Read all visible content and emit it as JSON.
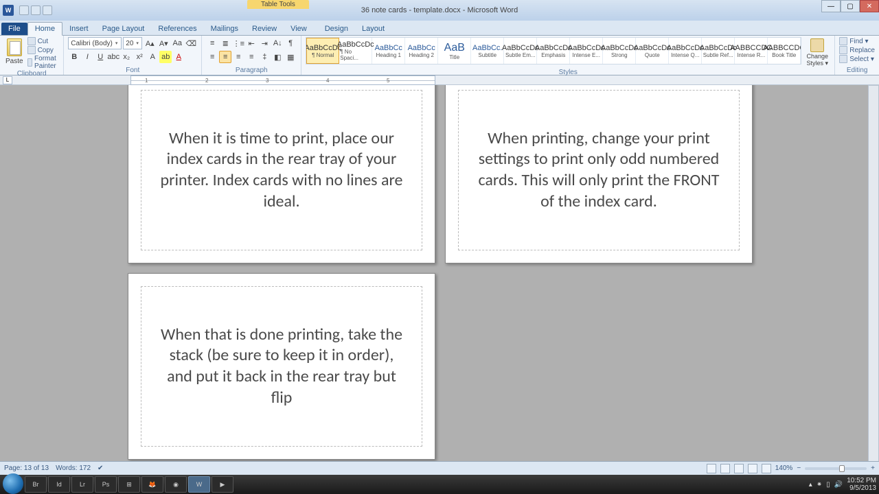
{
  "titlebar": {
    "app_letter": "W",
    "doc_title": "36 note cards - template.docx - Microsoft Word",
    "tool_tab": "Table Tools"
  },
  "tabs": {
    "file": "File",
    "items": [
      "Home",
      "Insert",
      "Page Layout",
      "References",
      "Mailings",
      "Review",
      "View",
      "Design",
      "Layout"
    ],
    "active": "Home"
  },
  "clipboard": {
    "label": "Clipboard",
    "paste": "Paste",
    "cut": "Cut",
    "copy": "Copy",
    "painter": "Format Painter"
  },
  "font": {
    "label": "Font",
    "name": "Calibri (Body)",
    "size": "20"
  },
  "paragraph": {
    "label": "Paragraph"
  },
  "styles": {
    "label": "Styles",
    "items": [
      {
        "prev": "AaBbCcDc",
        "name": "¶ Normal",
        "sel": true
      },
      {
        "prev": "AaBbCcDc",
        "name": "¶ No Spaci..."
      },
      {
        "prev": "AaBbCc",
        "name": "Heading 1",
        "blue": true
      },
      {
        "prev": "AaBbCc",
        "name": "Heading 2",
        "blue": true
      },
      {
        "prev": "AaB",
        "name": "Title",
        "blue": true,
        "big": true
      },
      {
        "prev": "AaBbCc.",
        "name": "Subtitle",
        "blue": true
      },
      {
        "prev": "AaBbCcDc",
        "name": "Subtle Em..."
      },
      {
        "prev": "AaBbCcDc",
        "name": "Emphasis"
      },
      {
        "prev": "AaBbCcDc",
        "name": "Intense E..."
      },
      {
        "prev": "AaBbCcDc",
        "name": "Strong"
      },
      {
        "prev": "AaBbCcDc",
        "name": "Quote"
      },
      {
        "prev": "AaBbCcDc",
        "name": "Intense Q..."
      },
      {
        "prev": "AaBbCcDc",
        "name": "Subtle Ref..."
      },
      {
        "prev": "AABBCCDC",
        "name": "Intense R..."
      },
      {
        "prev": "AABBCCDC",
        "name": "Book Title"
      }
    ],
    "change": "Change Styles ▾"
  },
  "editing": {
    "label": "Editing",
    "find": "Find ▾",
    "replace": "Replace",
    "select": "Select ▾"
  },
  "ruler_ticks": [
    "1",
    "2",
    "3",
    "4",
    "5"
  ],
  "cards": [
    "When it is time to print, place our index cards in the rear tray of your printer.  Index cards with no lines are ideal.",
    "When printing, change your print settings to print only odd numbered cards.  This will only print the FRONT of the index card.",
    "When that is done printing, take the stack (be sure to keep it in order), and put it back in the rear tray but flip"
  ],
  "status": {
    "page": "Page: 13 of 13",
    "words": "Words: 172",
    "zoom": "140%"
  },
  "taskbar": {
    "items": [
      "Br",
      "Id",
      "Lr",
      "Ps",
      "⊞",
      "🦊",
      "◉",
      "W",
      "▶"
    ],
    "time": "10:52 PM",
    "date": "9/5/2013"
  }
}
